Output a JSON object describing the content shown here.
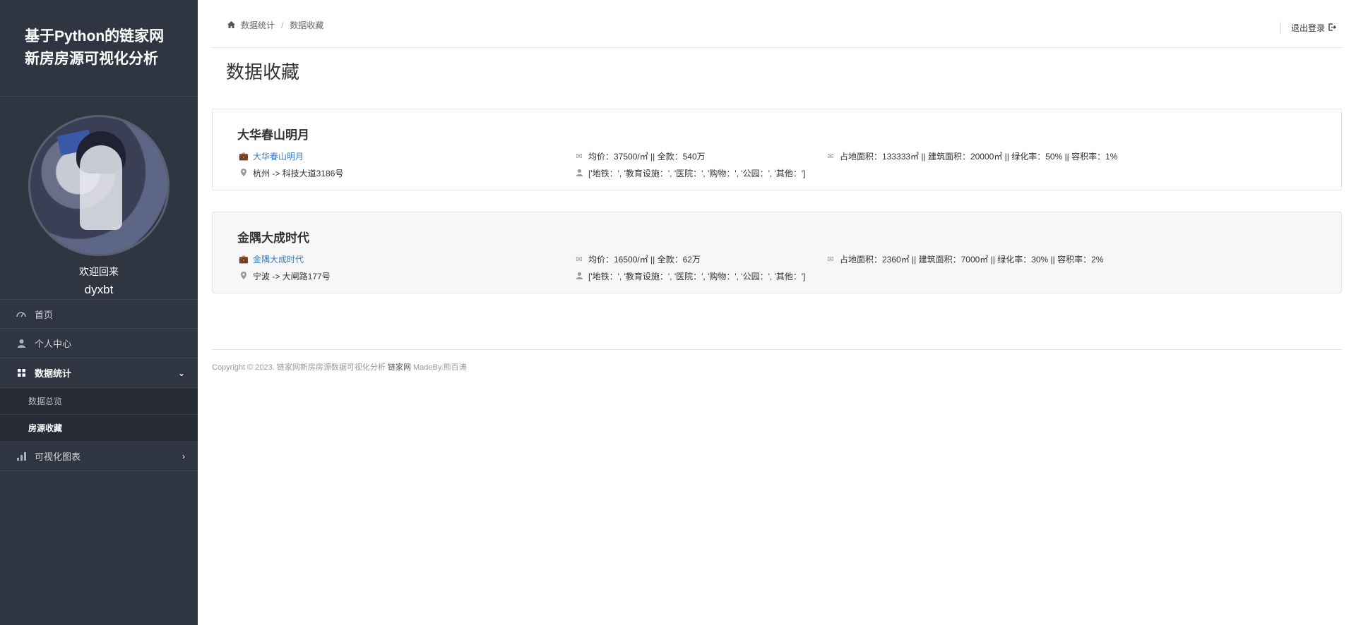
{
  "brand": {
    "line1": "基于Python的链家网",
    "line2": "新房房源可视化分析"
  },
  "profile": {
    "welcome": "欢迎回来",
    "username": "dyxbt"
  },
  "nav": {
    "home": "首页",
    "personal": "个人中心",
    "stats": "数据统计",
    "sub_overview": "数据总览",
    "sub_favorites": "房源收藏",
    "charts": "可视化图表"
  },
  "breadcrumb": {
    "root": "数据统计",
    "current": "数据收藏"
  },
  "logout": "退出登录",
  "page_title": "数据收藏",
  "cards": [
    {
      "title": "大华春山明月",
      "link": "大华春山明月",
      "location": "杭州 -> 科技大道3186号",
      "price": "均价：37500/㎡ || 全款：540万",
      "tags": "['地铁：', '教育设施：', '医院：', '购物：', '公园：', '其他：']",
      "area": "占地面积：133333㎡ || 建筑面积：20000㎡ || 绿化率：50% || 容积率：1%"
    },
    {
      "title": "金隅大成时代",
      "link": "金隅大成时代",
      "location": "宁波 -> 大闸路177号",
      "price": "均价：16500/㎡ || 全款：62万",
      "tags": "['地铁：', '教育设施：', '医院：', '购物：', '公园：', '其他：']",
      "area": "占地面积：2360㎡ || 建筑面积：7000㎡ || 绿化率：30% || 容积率：2%"
    }
  ],
  "footer": {
    "prefix": "Copyright © 2023. 链家网新房房源数据可视化分析",
    "site": "链家网",
    "suffix": "MadeBy.熊百涛"
  }
}
